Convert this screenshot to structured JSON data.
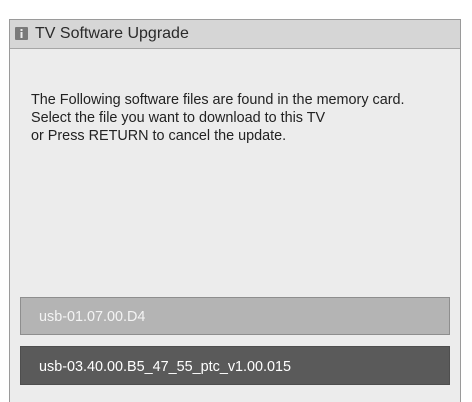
{
  "dialog": {
    "title": "TV Software Upgrade",
    "title_icon": "info-icon",
    "message_lines": [
      "The Following software files are found in the memory card.",
      "Select the file you want to download to this TV",
      "or Press RETURN to cancel the update."
    ],
    "files": [
      {
        "label": "usb-01.07.00.D4",
        "state": "normal"
      },
      {
        "label": "usb-03.40.00.B5_47_55_ptc_v1.00.015",
        "state": "highlighted"
      }
    ]
  },
  "colors": {
    "dialog_background": "#ececec",
    "titlebar_background": "#d6d6d6",
    "item_normal": "#b4b4b4",
    "item_highlighted": "#5a5a5a"
  }
}
